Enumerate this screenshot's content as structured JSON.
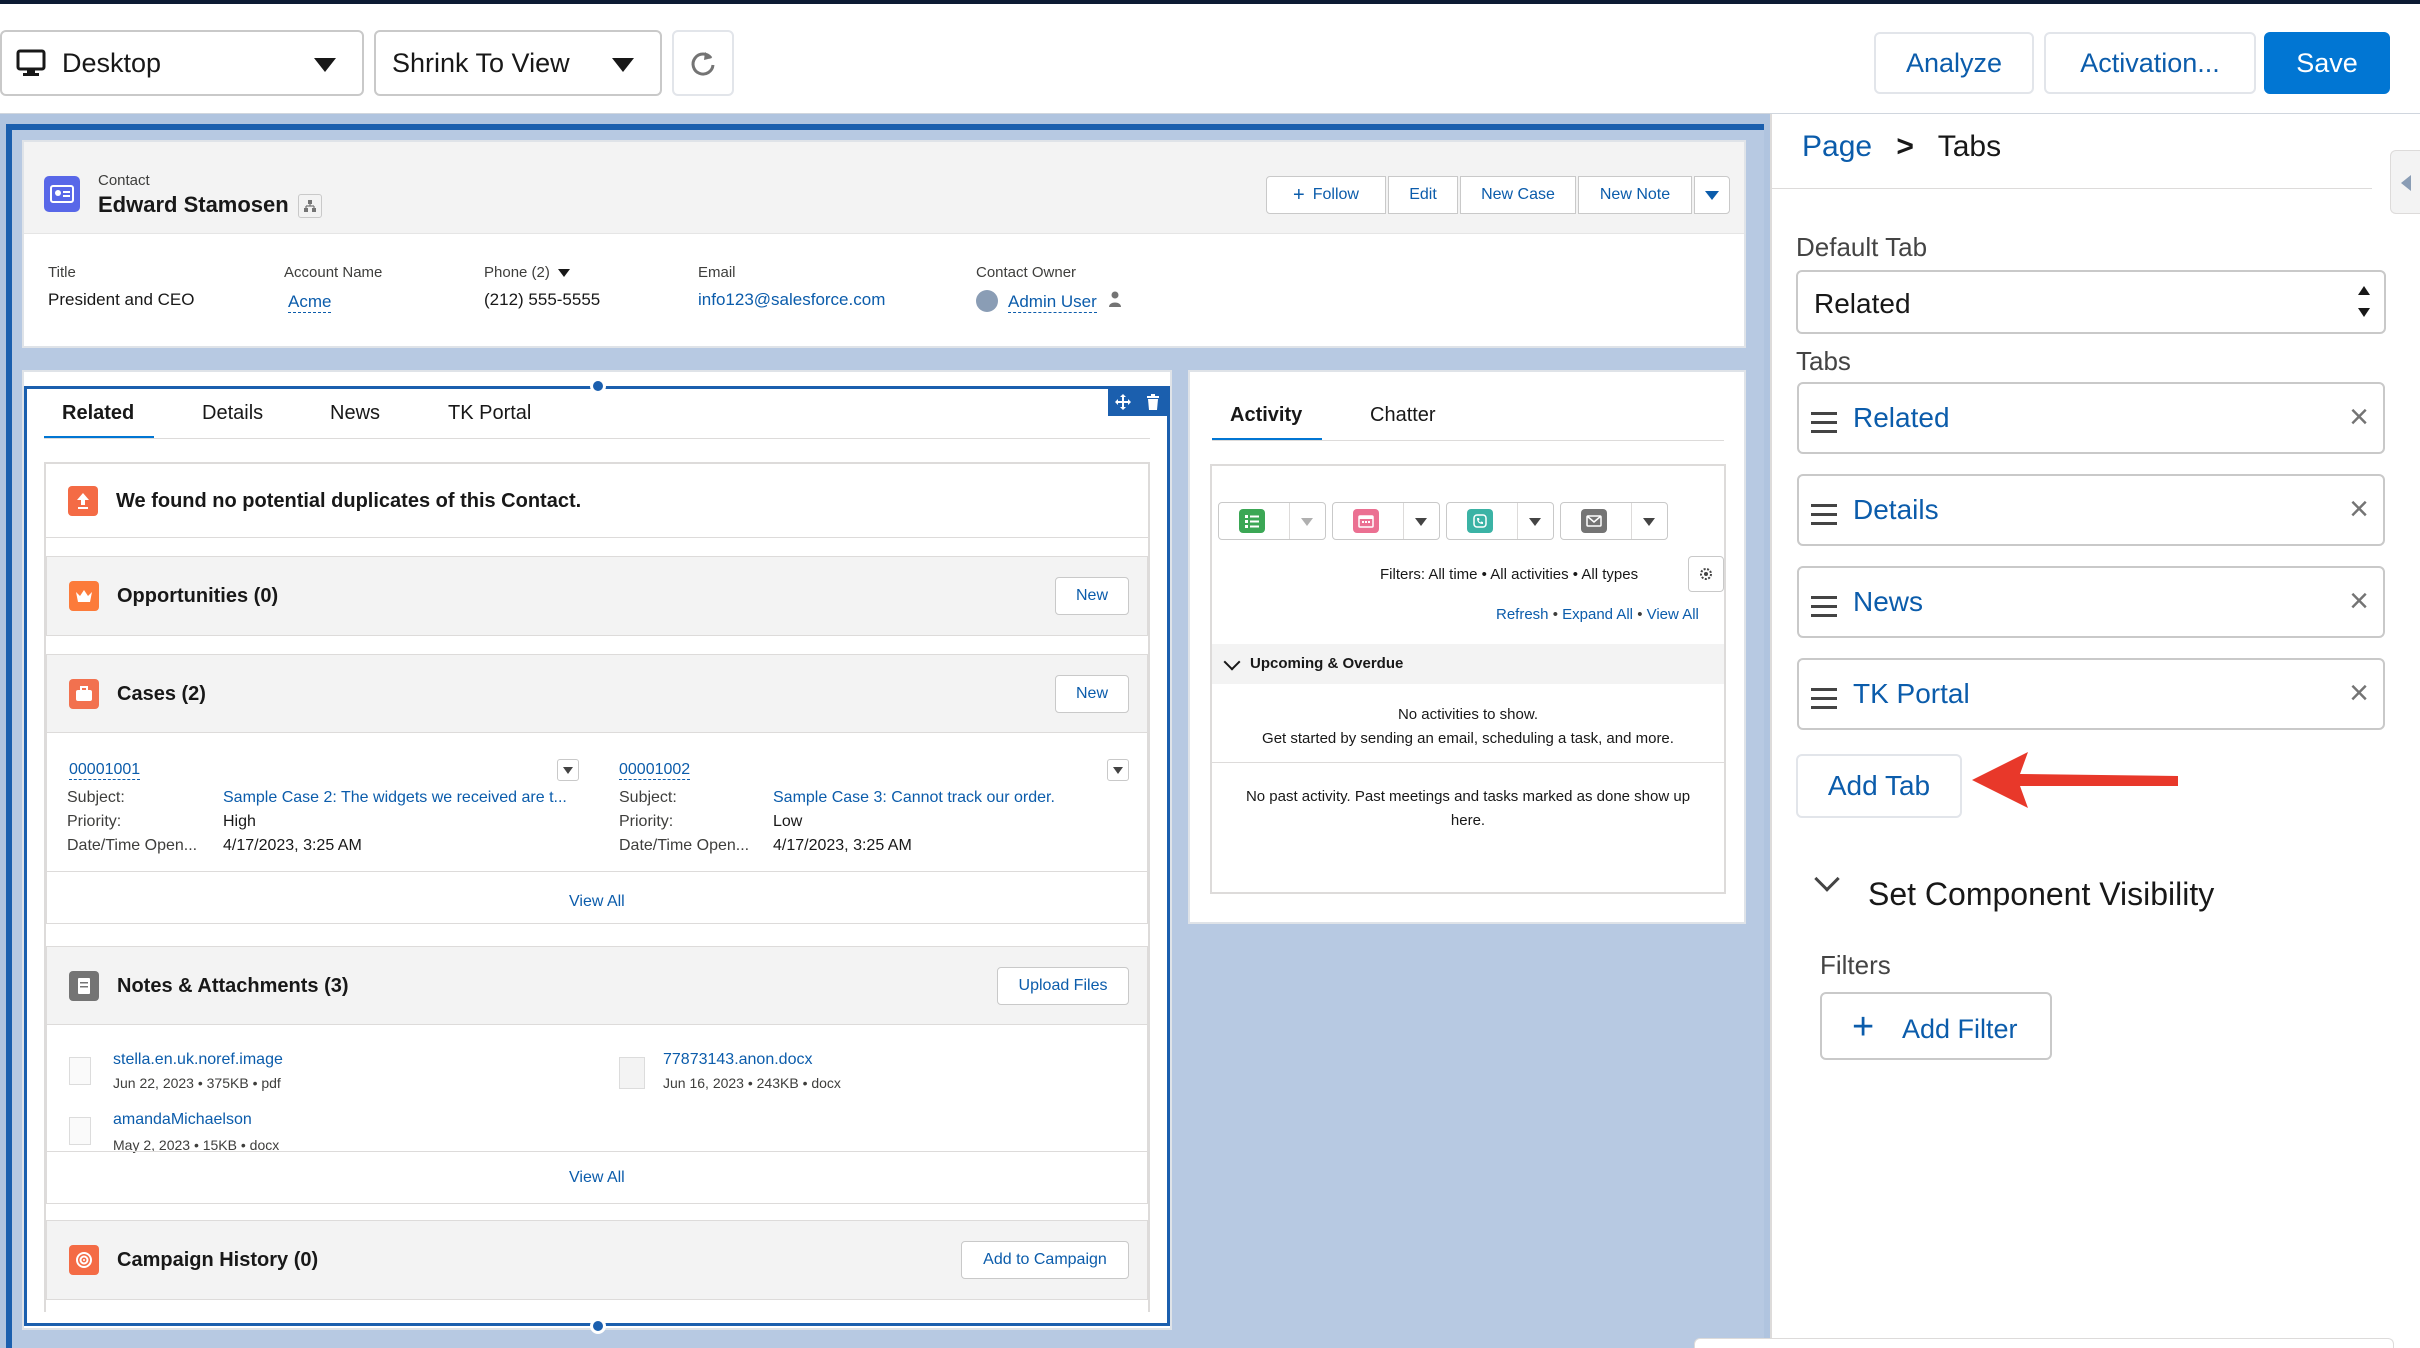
{
  "toolbar": {
    "device_label": "Desktop",
    "view_label": "Shrink To View",
    "analyze_label": "Analyze",
    "activation_label": "Activation...",
    "save_label": "Save"
  },
  "header": {
    "object_type": "Contact",
    "name": "Edward Stamosen",
    "buttons": {
      "follow": "Follow",
      "edit": "Edit",
      "new_case": "New Case",
      "new_note": "New Note"
    },
    "fields": [
      {
        "label": "Title",
        "value": "President and CEO"
      },
      {
        "label": "Account Name",
        "value": "Acme"
      },
      {
        "label": "Phone (2)",
        "value": "(212) 555-5555"
      },
      {
        "label": "Email",
        "value": "info123@salesforce.com"
      },
      {
        "label": "Contact Owner",
        "value": "Admin User"
      }
    ]
  },
  "left_tabs": [
    "Related",
    "Details",
    "News",
    "TK Portal"
  ],
  "duplicates_text": "We found no potential duplicates of this Contact.",
  "opportunities": {
    "title": "Opportunities (0)",
    "button": "New"
  },
  "cases": {
    "title": "Cases (2)",
    "button": "New",
    "labels": {
      "subject": "Subject:",
      "priority": "Priority:",
      "date": "Date/Time Open..."
    },
    "items": [
      {
        "number": "00001001",
        "subject": "Sample Case 2: The widgets we received are t...",
        "priority": "High",
        "date": "4/17/2023, 3:25 AM"
      },
      {
        "number": "00001002",
        "subject": "Sample Case 3: Cannot track our order.",
        "priority": "Low",
        "date": "4/17/2023, 3:25 AM"
      }
    ],
    "view_all": "View All"
  },
  "notes": {
    "title": "Notes & Attachments (3)",
    "button": "Upload Files",
    "files": [
      {
        "name": "stella.en.uk.noref.image",
        "meta": "Jun 22, 2023  •  375KB  •  pdf"
      },
      {
        "name": "77873143.anon.docx",
        "meta": "Jun 16, 2023  •  243KB  •  docx"
      },
      {
        "name": "amandaMichaelson",
        "meta": "May 2, 2023  •  15KB  •  docx"
      }
    ],
    "view_all": "View All"
  },
  "campaign": {
    "title": "Campaign History (0)",
    "button": "Add to Campaign"
  },
  "activity": {
    "tabs": [
      "Activity",
      "Chatter"
    ],
    "filters": "Filters: All time • All activities • All types",
    "links": {
      "refresh": "Refresh",
      "expand_all": "Expand All",
      "view_all": "View All"
    },
    "upcoming_title": "Upcoming & Overdue",
    "no_activities": "No activities to show.",
    "get_started": "Get started by sending an email, scheduling a task, and more.",
    "no_past_line1": "No past activity. Past meetings and tasks marked as done show up",
    "no_past_line2": "here."
  },
  "panel": {
    "breadcrumb_page": "Page",
    "breadcrumb_sep": ">",
    "breadcrumb_current": "Tabs",
    "default_tab_label": "Default Tab",
    "default_tab_value": "Related",
    "tabs_label": "Tabs",
    "tabs": [
      "Related",
      "Details",
      "News",
      "TK Portal"
    ],
    "add_tab": "Add Tab",
    "visibility_title": "Set Component Visibility",
    "filters_label": "Filters",
    "add_filter": "Add Filter"
  },
  "colors": {
    "brand_blue": "#0176d3",
    "link_blue": "#0b5cab",
    "annotation_arrow": "#e8382a"
  }
}
